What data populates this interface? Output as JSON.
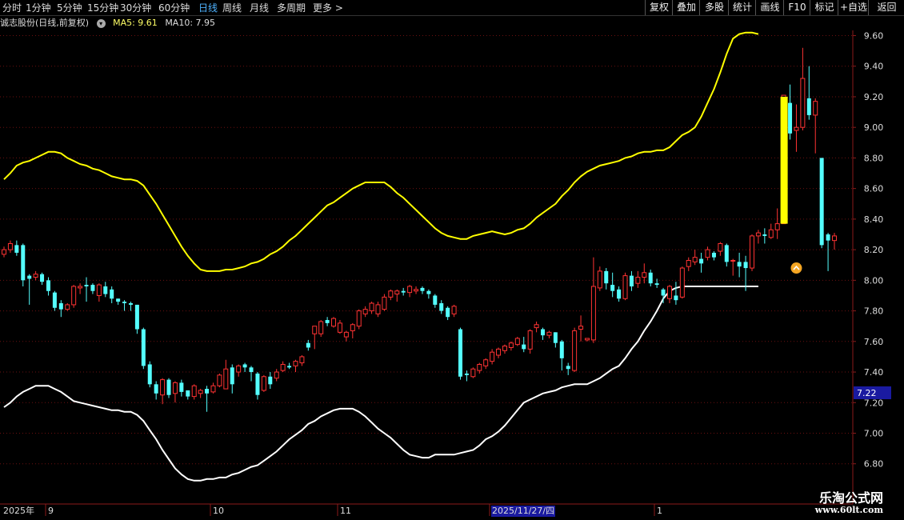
{
  "toolbar": {
    "timeframes": [
      "分时",
      "1分钟",
      "5分钟",
      "15分钟",
      "30分钟",
      "60分钟",
      "日线",
      "周线",
      "月线",
      "多周期",
      "更多 >"
    ],
    "active_index": 6,
    "right_buttons": [
      "复权",
      "叠加",
      "多股",
      "统计",
      "画线",
      "F10",
      "标记",
      "+自选",
      "返回"
    ]
  },
  "info": {
    "title": "诚志股份(日线,前复权)",
    "ma5_label": "MA5: 9.61",
    "ma10_label": "MA10: 7.95"
  },
  "colors": {
    "up": "#ff3333",
    "down": "#54ffff",
    "upper_band": "#ffff00",
    "lower_band": "#ffffff",
    "highlight_bar": "#ffff00",
    "grid": "#6b1010",
    "axis": "#8b1a1a"
  },
  "chart_data": {
    "type": "candlestick",
    "y_ticks": [
      "9.60",
      "9.40",
      "9.20",
      "9.00",
      "8.80",
      "8.60",
      "8.40",
      "8.20",
      "8.00",
      "7.80",
      "7.60",
      "7.40",
      "7.20",
      "7.00",
      "6.80"
    ],
    "y_range": [
      6.68,
      9.76
    ],
    "current_price_label": "7.22",
    "x_labels": [
      {
        "text": "2025年",
        "i": 0
      },
      {
        "text": "9",
        "i": 7
      },
      {
        "text": "10",
        "i": 33
      },
      {
        "text": "11",
        "i": 53
      },
      {
        "text": "2025/11/27/四",
        "i": 77
      },
      {
        "text": "1",
        "i": 103
      }
    ],
    "candles": [
      [
        8.17,
        8.2,
        8.15,
        8.22
      ],
      [
        8.2,
        8.24,
        8.18,
        8.26
      ],
      [
        8.23,
        8.18,
        8.16,
        8.26
      ],
      [
        8.23,
        8.0,
        7.96,
        8.24
      ],
      [
        8.03,
        8.01,
        7.84,
        8.04
      ],
      [
        8.02,
        8.04,
        8.0,
        8.06
      ],
      [
        8.04,
        7.99,
        7.97,
        8.05
      ],
      [
        8.0,
        7.93,
        7.9,
        8.02
      ],
      [
        7.92,
        7.82,
        7.8,
        7.93
      ],
      [
        7.85,
        7.81,
        7.76,
        7.87
      ],
      [
        7.81,
        7.84,
        7.8,
        7.85
      ],
      [
        7.84,
        7.96,
        7.82,
        7.97
      ],
      [
        7.95,
        7.96,
        7.91,
        7.98
      ],
      [
        7.97,
        7.96,
        7.86,
        8.02
      ],
      [
        7.97,
        7.93,
        7.91,
        7.98
      ],
      [
        7.9,
        7.97,
        7.86,
        7.98
      ],
      [
        7.96,
        7.91,
        7.89,
        7.99
      ],
      [
        7.94,
        7.88,
        7.85,
        7.96
      ],
      [
        7.88,
        7.86,
        7.84,
        7.88
      ],
      [
        7.86,
        7.85,
        7.8,
        7.87
      ],
      [
        7.85,
        7.84,
        7.8,
        7.86
      ],
      [
        7.84,
        7.68,
        7.65,
        7.84
      ],
      [
        7.68,
        7.44,
        7.42,
        7.69
      ],
      [
        7.45,
        7.32,
        7.3,
        7.47
      ],
      [
        7.32,
        7.26,
        7.22,
        7.34
      ],
      [
        7.25,
        7.35,
        7.19,
        7.36
      ],
      [
        7.35,
        7.25,
        7.23,
        7.36
      ],
      [
        7.26,
        7.33,
        7.2,
        7.34
      ],
      [
        7.33,
        7.27,
        7.24,
        7.35
      ],
      [
        7.28,
        7.24,
        7.22,
        7.28
      ],
      [
        7.24,
        7.31,
        7.22,
        7.32
      ],
      [
        7.26,
        7.28,
        7.23,
        7.29
      ],
      [
        7.29,
        7.26,
        7.14,
        7.31
      ],
      [
        7.27,
        7.31,
        7.26,
        7.33
      ],
      [
        7.31,
        7.38,
        7.3,
        7.39
      ],
      [
        7.29,
        7.42,
        7.29,
        7.48
      ],
      [
        7.43,
        7.32,
        7.26,
        7.45
      ],
      [
        7.4,
        7.44,
        7.37,
        7.45
      ],
      [
        7.45,
        7.43,
        7.4,
        7.46
      ],
      [
        7.43,
        7.4,
        7.34,
        7.44
      ],
      [
        7.39,
        7.25,
        7.22,
        7.4
      ],
      [
        7.28,
        7.37,
        7.27,
        7.38
      ],
      [
        7.37,
        7.32,
        7.29,
        7.4
      ],
      [
        7.36,
        7.4,
        7.34,
        7.42
      ],
      [
        7.41,
        7.45,
        7.4,
        7.47
      ],
      [
        7.44,
        7.43,
        7.42,
        7.46
      ],
      [
        7.44,
        7.47,
        7.4,
        7.48
      ],
      [
        7.46,
        7.5,
        7.44,
        7.51
      ],
      [
        7.59,
        7.56,
        7.54,
        7.61
      ],
      [
        7.65,
        7.7,
        7.55,
        7.7
      ],
      [
        7.65,
        7.73,
        7.63,
        7.74
      ],
      [
        7.74,
        7.72,
        7.7,
        7.76
      ],
      [
        7.7,
        7.75,
        7.69,
        7.76
      ],
      [
        7.66,
        7.72,
        7.65,
        7.74
      ],
      [
        7.63,
        7.66,
        7.6,
        7.67
      ],
      [
        7.67,
        7.71,
        7.62,
        7.72
      ],
      [
        7.7,
        7.8,
        7.68,
        7.81
      ],
      [
        7.78,
        7.81,
        7.76,
        7.83
      ],
      [
        7.8,
        7.85,
        7.78,
        7.86
      ],
      [
        7.78,
        7.84,
        7.76,
        7.86
      ],
      [
        7.81,
        7.89,
        7.8,
        7.91
      ],
      [
        7.89,
        7.93,
        7.87,
        7.94
      ],
      [
        7.91,
        7.93,
        7.86,
        7.94
      ],
      [
        7.93,
        7.92,
        7.9,
        7.95
      ],
      [
        7.92,
        7.96,
        7.89,
        7.97
      ],
      [
        7.93,
        7.94,
        7.91,
        7.96
      ],
      [
        7.95,
        7.93,
        7.91,
        7.96
      ],
      [
        7.93,
        7.91,
        7.88,
        7.94
      ],
      [
        7.9,
        7.84,
        7.82,
        7.91
      ],
      [
        7.85,
        7.8,
        7.78,
        7.87
      ],
      [
        7.82,
        7.76,
        7.74,
        7.83
      ],
      [
        7.78,
        7.83,
        7.76,
        7.84
      ],
      [
        7.68,
        7.37,
        7.35,
        7.69
      ],
      [
        7.39,
        7.38,
        7.34,
        7.41
      ],
      [
        7.37,
        7.42,
        7.36,
        7.43
      ],
      [
        7.41,
        7.45,
        7.39,
        7.46
      ],
      [
        7.44,
        7.48,
        7.42,
        7.49
      ],
      [
        7.47,
        7.53,
        7.45,
        7.55
      ],
      [
        7.51,
        7.55,
        7.49,
        7.56
      ],
      [
        7.54,
        7.57,
        7.52,
        7.58
      ],
      [
        7.56,
        7.59,
        7.54,
        7.6
      ],
      [
        7.58,
        7.62,
        7.57,
        7.63
      ],
      [
        7.58,
        7.55,
        7.53,
        7.63
      ],
      [
        7.55,
        7.67,
        7.52,
        7.68
      ],
      [
        7.69,
        7.71,
        7.66,
        7.73
      ],
      [
        7.68,
        7.64,
        7.61,
        7.69
      ],
      [
        7.64,
        7.66,
        7.62,
        7.67
      ],
      [
        7.66,
        7.59,
        7.56,
        7.66
      ],
      [
        7.6,
        7.49,
        7.41,
        7.61
      ],
      [
        7.44,
        7.42,
        7.38,
        7.46
      ],
      [
        7.41,
        7.67,
        7.4,
        7.69
      ],
      [
        7.68,
        7.7,
        7.6,
        7.77
      ],
      [
        7.61,
        7.62,
        7.6,
        7.62
      ],
      [
        7.61,
        7.96,
        7.59,
        8.15
      ],
      [
        7.95,
        8.06,
        7.93,
        8.09
      ],
      [
        8.06,
        7.98,
        7.94,
        8.08
      ],
      [
        7.97,
        7.93,
        7.89,
        8.05
      ],
      [
        7.94,
        7.88,
        7.86,
        7.96
      ],
      [
        7.88,
        8.03,
        7.87,
        8.05
      ],
      [
        8.03,
        7.96,
        7.93,
        8.06
      ],
      [
        7.98,
        8.02,
        7.95,
        8.06
      ],
      [
        8.02,
        8.05,
        7.98,
        8.11
      ],
      [
        8.05,
        7.98,
        7.96,
        8.07
      ],
      [
        7.98,
        7.97,
        7.95,
        8.01
      ],
      [
        7.94,
        7.9,
        7.85,
        7.95
      ],
      [
        7.88,
        7.96,
        7.85,
        7.97
      ],
      [
        7.9,
        7.87,
        7.84,
        7.99
      ],
      [
        7.89,
        8.08,
        7.88,
        8.09
      ],
      [
        8.09,
        8.13,
        8.06,
        8.15
      ],
      [
        8.12,
        8.15,
        8.1,
        8.2
      ],
      [
        8.14,
        8.11,
        8.05,
        8.18
      ],
      [
        8.15,
        8.2,
        8.13,
        8.22
      ],
      [
        8.18,
        8.15,
        8.13,
        8.19
      ],
      [
        8.19,
        8.24,
        8.16,
        8.25
      ],
      [
        8.23,
        8.12,
        8.09,
        8.24
      ],
      [
        8.13,
        8.13,
        8.03,
        8.14
      ],
      [
        8.12,
        8.09,
        8.02,
        8.18
      ],
      [
        8.12,
        8.08,
        7.93,
        8.16
      ],
      [
        8.08,
        8.29,
        8.06,
        8.3
      ],
      [
        8.29,
        8.31,
        8.24,
        8.33
      ],
      [
        8.3,
        8.29,
        8.24,
        8.34
      ],
      [
        8.28,
        8.33,
        8.27,
        8.37
      ],
      [
        8.33,
        8.37,
        8.27,
        8.47
      ],
      [
        8.37,
        9.21,
        8.37,
        9.21
      ],
      [
        9.16,
        8.96,
        8.92,
        9.28
      ],
      [
        8.98,
        9.0,
        8.84,
        9.15
      ],
      [
        9.0,
        9.32,
        8.98,
        9.52
      ],
      [
        9.19,
        9.08,
        9.05,
        9.4
      ],
      [
        9.08,
        9.17,
        8.83,
        9.19
      ],
      [
        8.8,
        8.23,
        8.21,
        8.8
      ],
      [
        8.3,
        8.26,
        8.06,
        8.31
      ],
      [
        8.26,
        8.29,
        8.2,
        8.31
      ]
    ],
    "upper_band": [
      8.66,
      8.7,
      8.75,
      8.77,
      8.78,
      8.8,
      8.82,
      8.84,
      8.84,
      8.83,
      8.8,
      8.78,
      8.76,
      8.75,
      8.73,
      8.72,
      8.7,
      8.68,
      8.67,
      8.66,
      8.66,
      8.65,
      8.62,
      8.56,
      8.5,
      8.43,
      8.36,
      8.29,
      8.22,
      8.16,
      8.11,
      8.07,
      8.06,
      8.06,
      8.06,
      8.07,
      8.07,
      8.08,
      8.09,
      8.11,
      8.12,
      8.14,
      8.17,
      8.19,
      8.22,
      8.26,
      8.29,
      8.33,
      8.37,
      8.41,
      8.45,
      8.49,
      8.51,
      8.54,
      8.57,
      8.6,
      8.62,
      8.64,
      8.64,
      8.64,
      8.64,
      8.61,
      8.57,
      8.54,
      8.5,
      8.46,
      8.42,
      8.38,
      8.34,
      8.31,
      8.29,
      8.28,
      8.27,
      8.27,
      8.29,
      8.3,
      8.31,
      8.32,
      8.31,
      8.3,
      8.31,
      8.33,
      8.34,
      8.37,
      8.41,
      8.44,
      8.47,
      8.5,
      8.55,
      8.59,
      8.64,
      8.68,
      8.71,
      8.73,
      8.75,
      8.76,
      8.77,
      8.78,
      8.8,
      8.81,
      8.83,
      8.84,
      8.84,
      8.85,
      8.85,
      8.87,
      8.91,
      8.95,
      8.97,
      9.0,
      9.07,
      9.16,
      9.25,
      9.36,
      9.48,
      9.58,
      9.61,
      9.62,
      9.62,
      9.61
    ],
    "lower_band": [
      7.17,
      7.2,
      7.24,
      7.27,
      7.29,
      7.31,
      7.31,
      7.31,
      7.29,
      7.27,
      7.24,
      7.21,
      7.2,
      7.19,
      7.18,
      7.17,
      7.16,
      7.15,
      7.15,
      7.14,
      7.14,
      7.12,
      7.08,
      7.02,
      6.96,
      6.89,
      6.83,
      6.77,
      6.73,
      6.7,
      6.69,
      6.69,
      6.7,
      6.7,
      6.71,
      6.71,
      6.73,
      6.74,
      6.76,
      6.78,
      6.79,
      6.82,
      6.85,
      6.88,
      6.92,
      6.96,
      6.99,
      7.02,
      7.06,
      7.08,
      7.11,
      7.13,
      7.15,
      7.16,
      7.16,
      7.16,
      7.14,
      7.11,
      7.07,
      7.03,
      7.0,
      6.97,
      6.93,
      6.89,
      6.86,
      6.85,
      6.84,
      6.84,
      6.86,
      6.86,
      6.86,
      6.86,
      6.87,
      6.88,
      6.89,
      6.92,
      6.96,
      6.98,
      7.01,
      7.05,
      7.1,
      7.15,
      7.2,
      7.22,
      7.24,
      7.26,
      7.27,
      7.28,
      7.3,
      7.31,
      7.32,
      7.32,
      7.32,
      7.34,
      7.36,
      7.39,
      7.42,
      7.44,
      7.49,
      7.55,
      7.6,
      7.67,
      7.73,
      7.8,
      7.88,
      7.93,
      7.95,
      7.96,
      7.96,
      7.96,
      7.96,
      7.96,
      7.96,
      7.96,
      7.96,
      7.96,
      7.96,
      7.96,
      7.96,
      7.96
    ],
    "highlight_bar": {
      "i": 123,
      "low": 8.37,
      "high": 9.2
    },
    "signal_marker": {
      "i": 125,
      "price": 8.08
    }
  },
  "watermark": {
    "line1": "乐淘公式网",
    "line2": "www.60lt.com"
  }
}
